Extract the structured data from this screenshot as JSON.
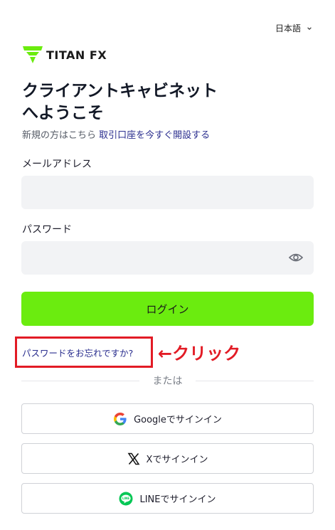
{
  "header": {
    "language": "日本語"
  },
  "brand": {
    "name": "TITAN FX",
    "color": "#6bec0f"
  },
  "main": {
    "title_line1": "クライアントキャビネット",
    "title_line2": "へようこそ",
    "new_prompt": "新規の方はこちら",
    "open_account_link": "取引口座を今すぐ開設する",
    "email_label": "メールアドレス",
    "email_value": "",
    "password_label": "パスワード",
    "password_value": "",
    "login_button": "ログイン",
    "forgot_password": "パスワードをお忘れですか?",
    "annotation": "←クリック",
    "or_text": "または",
    "google_signin": "Googleでサインイン",
    "x_signin": "Xでサインイン",
    "line_signin": "LINEでサインイン"
  },
  "colors": {
    "accent": "#6bec0f",
    "link": "#2b2f8f",
    "annotation": "#e21b25",
    "input_bg": "#f2f3f5"
  },
  "icons": [
    "chevron-down-icon",
    "titan-logo-icon",
    "eye-icon",
    "google-icon",
    "x-icon",
    "line-icon"
  ]
}
